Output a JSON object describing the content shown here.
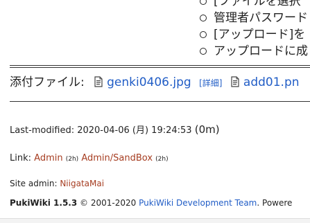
{
  "top_list": {
    "items": [
      "[ファイルを選択",
      "管理者パスワード",
      "[アップロード]を",
      "アップロードに成"
    ]
  },
  "attachments": {
    "label": "添付ファイル:",
    "files": [
      {
        "name": "genki0406.jpg",
        "detail_label": "[詳細]"
      },
      {
        "name": "add01.pn",
        "detail_label": ""
      }
    ]
  },
  "last_modified": {
    "label": "Last-modified:",
    "value": "2020-04-06 (月) 19:24:53",
    "passage": "(0m)"
  },
  "related_links": {
    "label": "Link:",
    "links": [
      {
        "title": "Admin",
        "age": "(2h)"
      },
      {
        "title": "Admin/SandBox",
        "age": "(2h)"
      }
    ]
  },
  "site_admin": {
    "label": "Site admin:",
    "name": "NiigataMai"
  },
  "credit": {
    "product": "PukiWiki 1.5.3",
    "copyright": "© 2001-2020",
    "team_link": "PukiWiki Development Team",
    "suffix": ". Powere"
  },
  "icons": {
    "attachment_file": "file-attachment-icon",
    "list_bullet": "open-circle-bullet"
  },
  "colors": {
    "link_blue": "#215dc6",
    "link_related": "#a63d21",
    "text": "#222222"
  }
}
